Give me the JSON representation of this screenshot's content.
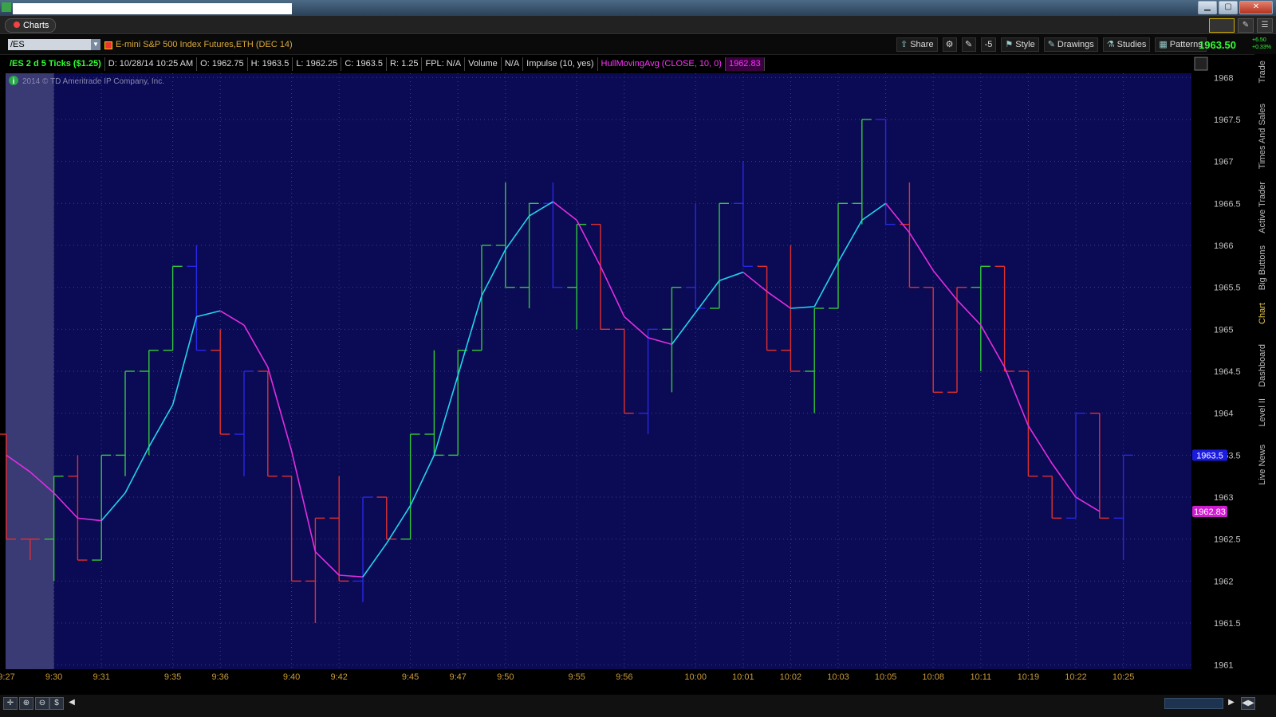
{
  "window": {
    "minimize_label": "▁",
    "restore_label": "▢",
    "close_label": "✕"
  },
  "tabbar": {
    "tab_label": "Charts"
  },
  "toolbar": {
    "symbol": "/ES",
    "description": "E-mini S&P 500 Index Futures,ETH (DEC 14)",
    "share": "Share",
    "style": "Style",
    "drawings": "Drawings",
    "studies": "Studies",
    "patterns": "Patterns",
    "last_price": "1963.50",
    "change_abs": "+6.50",
    "change_pct": "+0.33%",
    "zoom_box": "-5"
  },
  "infobar": {
    "chart_label": "/ES 2 d 5 Ticks ($1.25)",
    "date": "D: 10/28/14 10:25 AM",
    "open": "O: 1962.75",
    "high": "H: 1963.5",
    "low": "L: 1962.25",
    "close": "C: 1963.5",
    "range": "R: 1.25",
    "fpl": "FPL: N/A",
    "volume": "Volume",
    "volume_val": "N/A",
    "impulse": "Impulse (10, yes)",
    "hma_label": "HullMovingAvg (CLOSE, 10, 0)",
    "hma_value": "1962.83"
  },
  "copyright": "2014 © TD Ameritrade IP Company, Inc.",
  "sidetabs": [
    "Trade",
    "Times And Sales",
    "Active Trader",
    "Big Buttons",
    "Chart",
    "Dashboard",
    "Level II",
    "Live News"
  ],
  "colors": {
    "background": "#0b0a54",
    "up": "#32c83c",
    "down": "#e03030",
    "neutral": "#2828e6",
    "hma_up": "#22d4ee",
    "hma_down": "#e12ee0",
    "grid": "#3c3c8c",
    "axis_text": "#c89a3a"
  },
  "chart_data": {
    "type": "line",
    "bar_style": "5-tick Heikin/range OHLC bars",
    "y_ticks": [
      1968,
      1967.5,
      1967,
      1966.5,
      1966,
      1965.5,
      1965,
      1964.5,
      1964,
      1963.5,
      1963,
      1962.5,
      1962,
      1961.5,
      1961
    ],
    "ylim": [
      1960.95,
      1968.05
    ],
    "x_ticks": [
      "9:27",
      "9:30",
      "9:31",
      "9:35",
      "9:36",
      "9:40",
      "9:42",
      "9:45",
      "9:47",
      "9:50",
      "9:55",
      "9:56",
      "10:00",
      "10:01",
      "10:02",
      "10:03",
      "10:05",
      "10:08",
      "10:11",
      "10:19",
      "10:22",
      "10:25"
    ],
    "x_tick_bar_index": [
      0,
      2,
      4,
      7,
      9,
      12,
      14,
      17,
      19,
      21,
      24,
      26,
      29,
      31,
      33,
      35,
      37,
      39,
      41,
      43,
      45,
      47
    ],
    "price_label_last": "1963.5",
    "price_label_hma": "1962.83",
    "bars": [
      {
        "o": 1963.75,
        "h": 1963.75,
        "l": 1962.5,
        "c": 1962.5,
        "color": "down"
      },
      {
        "o": 1962.5,
        "h": 1962.5,
        "l": 1962.25,
        "c": 1962.5,
        "color": "down"
      },
      {
        "o": 1962.5,
        "h": 1963.25,
        "l": 1962,
        "c": 1963.25,
        "color": "up"
      },
      {
        "o": 1963.25,
        "h": 1963.5,
        "l": 1962.25,
        "c": 1962.25,
        "color": "down"
      },
      {
        "o": 1962.25,
        "h": 1963.5,
        "l": 1962.25,
        "c": 1963.5,
        "color": "up"
      },
      {
        "o": 1963.5,
        "h": 1964.5,
        "l": 1963.25,
        "c": 1964.5,
        "color": "up"
      },
      {
        "o": 1964.5,
        "h": 1964.75,
        "l": 1963.5,
        "c": 1964.75,
        "color": "up"
      },
      {
        "o": 1964.75,
        "h": 1965.75,
        "l": 1964.75,
        "c": 1965.75,
        "color": "up"
      },
      {
        "o": 1965.75,
        "h": 1966,
        "l": 1964.75,
        "c": 1964.75,
        "color": "neutral"
      },
      {
        "o": 1964.75,
        "h": 1965,
        "l": 1963.75,
        "c": 1963.75,
        "color": "down"
      },
      {
        "o": 1963.75,
        "h": 1964.5,
        "l": 1963.25,
        "c": 1964.5,
        "color": "neutral"
      },
      {
        "o": 1964.5,
        "h": 1964.5,
        "l": 1963.25,
        "c": 1963.25,
        "color": "down"
      },
      {
        "o": 1963.25,
        "h": 1963.25,
        "l": 1962,
        "c": 1962,
        "color": "down"
      },
      {
        "o": 1962,
        "h": 1962.75,
        "l": 1961.5,
        "c": 1962.75,
        "color": "down"
      },
      {
        "o": 1962.75,
        "h": 1963.25,
        "l": 1962,
        "c": 1962,
        "color": "down"
      },
      {
        "o": 1962,
        "h": 1963,
        "l": 1961.75,
        "c": 1963,
        "color": "neutral"
      },
      {
        "o": 1963,
        "h": 1963,
        "l": 1962.5,
        "c": 1962.5,
        "color": "down"
      },
      {
        "o": 1962.5,
        "h": 1963.75,
        "l": 1962.5,
        "c": 1963.75,
        "color": "up"
      },
      {
        "o": 1963.75,
        "h": 1964.75,
        "l": 1963.5,
        "c": 1963.5,
        "color": "up"
      },
      {
        "o": 1963.5,
        "h": 1964.75,
        "l": 1963.5,
        "c": 1964.75,
        "color": "up"
      },
      {
        "o": 1964.75,
        "h": 1966,
        "l": 1964.75,
        "c": 1966,
        "color": "up"
      },
      {
        "o": 1966,
        "h": 1966.75,
        "l": 1965.5,
        "c": 1965.5,
        "color": "up"
      },
      {
        "o": 1965.5,
        "h": 1966.5,
        "l": 1965.25,
        "c": 1966.5,
        "color": "up"
      },
      {
        "o": 1966.5,
        "h": 1966.75,
        "l": 1965.5,
        "c": 1965.5,
        "color": "neutral"
      },
      {
        "o": 1965.5,
        "h": 1966.25,
        "l": 1965,
        "c": 1966.25,
        "color": "up"
      },
      {
        "o": 1966.25,
        "h": 1966.25,
        "l": 1965,
        "c": 1965,
        "color": "down"
      },
      {
        "o": 1965,
        "h": 1965,
        "l": 1964,
        "c": 1964,
        "color": "down"
      },
      {
        "o": 1964,
        "h": 1965,
        "l": 1963.75,
        "c": 1965,
        "color": "neutral"
      },
      {
        "o": 1965,
        "h": 1965.5,
        "l": 1964.25,
        "c": 1965.5,
        "color": "up"
      },
      {
        "o": 1965.5,
        "h": 1966.5,
        "l": 1965.25,
        "c": 1965.25,
        "color": "neutral"
      },
      {
        "o": 1965.25,
        "h": 1966.5,
        "l": 1965.25,
        "c": 1966.5,
        "color": "up"
      },
      {
        "o": 1966.5,
        "h": 1967,
        "l": 1965.75,
        "c": 1965.75,
        "color": "neutral"
      },
      {
        "o": 1965.75,
        "h": 1965.75,
        "l": 1964.75,
        "c": 1964.75,
        "color": "down"
      },
      {
        "o": 1964.75,
        "h": 1966,
        "l": 1964.5,
        "c": 1964.5,
        "color": "down"
      },
      {
        "o": 1964.5,
        "h": 1965.25,
        "l": 1964,
        "c": 1965.25,
        "color": "up"
      },
      {
        "o": 1965.25,
        "h": 1966.5,
        "l": 1965.25,
        "c": 1966.5,
        "color": "up"
      },
      {
        "o": 1966.5,
        "h": 1967.5,
        "l": 1966.25,
        "c": 1967.5,
        "color": "up"
      },
      {
        "o": 1967.5,
        "h": 1967.5,
        "l": 1966.25,
        "c": 1966.25,
        "color": "neutral"
      },
      {
        "o": 1966.25,
        "h": 1966.75,
        "l": 1965.5,
        "c": 1965.5,
        "color": "down"
      },
      {
        "o": 1965.5,
        "h": 1965.5,
        "l": 1964.25,
        "c": 1964.25,
        "color": "down"
      },
      {
        "o": 1964.25,
        "h": 1965.5,
        "l": 1964.25,
        "c": 1965.5,
        "color": "down"
      },
      {
        "o": 1965.5,
        "h": 1965.75,
        "l": 1964.5,
        "c": 1965.75,
        "color": "up"
      },
      {
        "o": 1965.75,
        "h": 1965.75,
        "l": 1964.5,
        "c": 1964.5,
        "color": "down"
      },
      {
        "o": 1964.5,
        "h": 1964.5,
        "l": 1963.25,
        "c": 1963.25,
        "color": "down"
      },
      {
        "o": 1963.25,
        "h": 1963.25,
        "l": 1962.75,
        "c": 1962.75,
        "color": "down"
      },
      {
        "o": 1962.75,
        "h": 1964,
        "l": 1962.75,
        "c": 1964,
        "color": "neutral"
      },
      {
        "o": 1964,
        "h": 1964,
        "l": 1962.75,
        "c": 1962.75,
        "color": "down"
      },
      {
        "o": 1962.75,
        "h": 1963.5,
        "l": 1962.25,
        "c": 1963.5,
        "color": "neutral"
      }
    ],
    "hma": [
      1963.5,
      1963.3,
      1963.05,
      1962.75,
      1962.72,
      1963.05,
      1963.6,
      1964.1,
      1965.15,
      1965.22,
      1965.05,
      1964.55,
      1963.55,
      1962.35,
      1962.07,
      1962.05,
      1962.45,
      1962.9,
      1963.5,
      1964.45,
      1965.4,
      1965.95,
      1966.35,
      1966.52,
      1966.3,
      1965.75,
      1965.15,
      1964.9,
      1964.82,
      1965.2,
      1965.58,
      1965.68,
      1965.45,
      1965.25,
      1965.27,
      1965.8,
      1966.3,
      1966.5,
      1966.15,
      1965.7,
      1965.35,
      1965.05,
      1964.55,
      1963.85,
      1963.4,
      1963,
      1962.83
    ]
  }
}
